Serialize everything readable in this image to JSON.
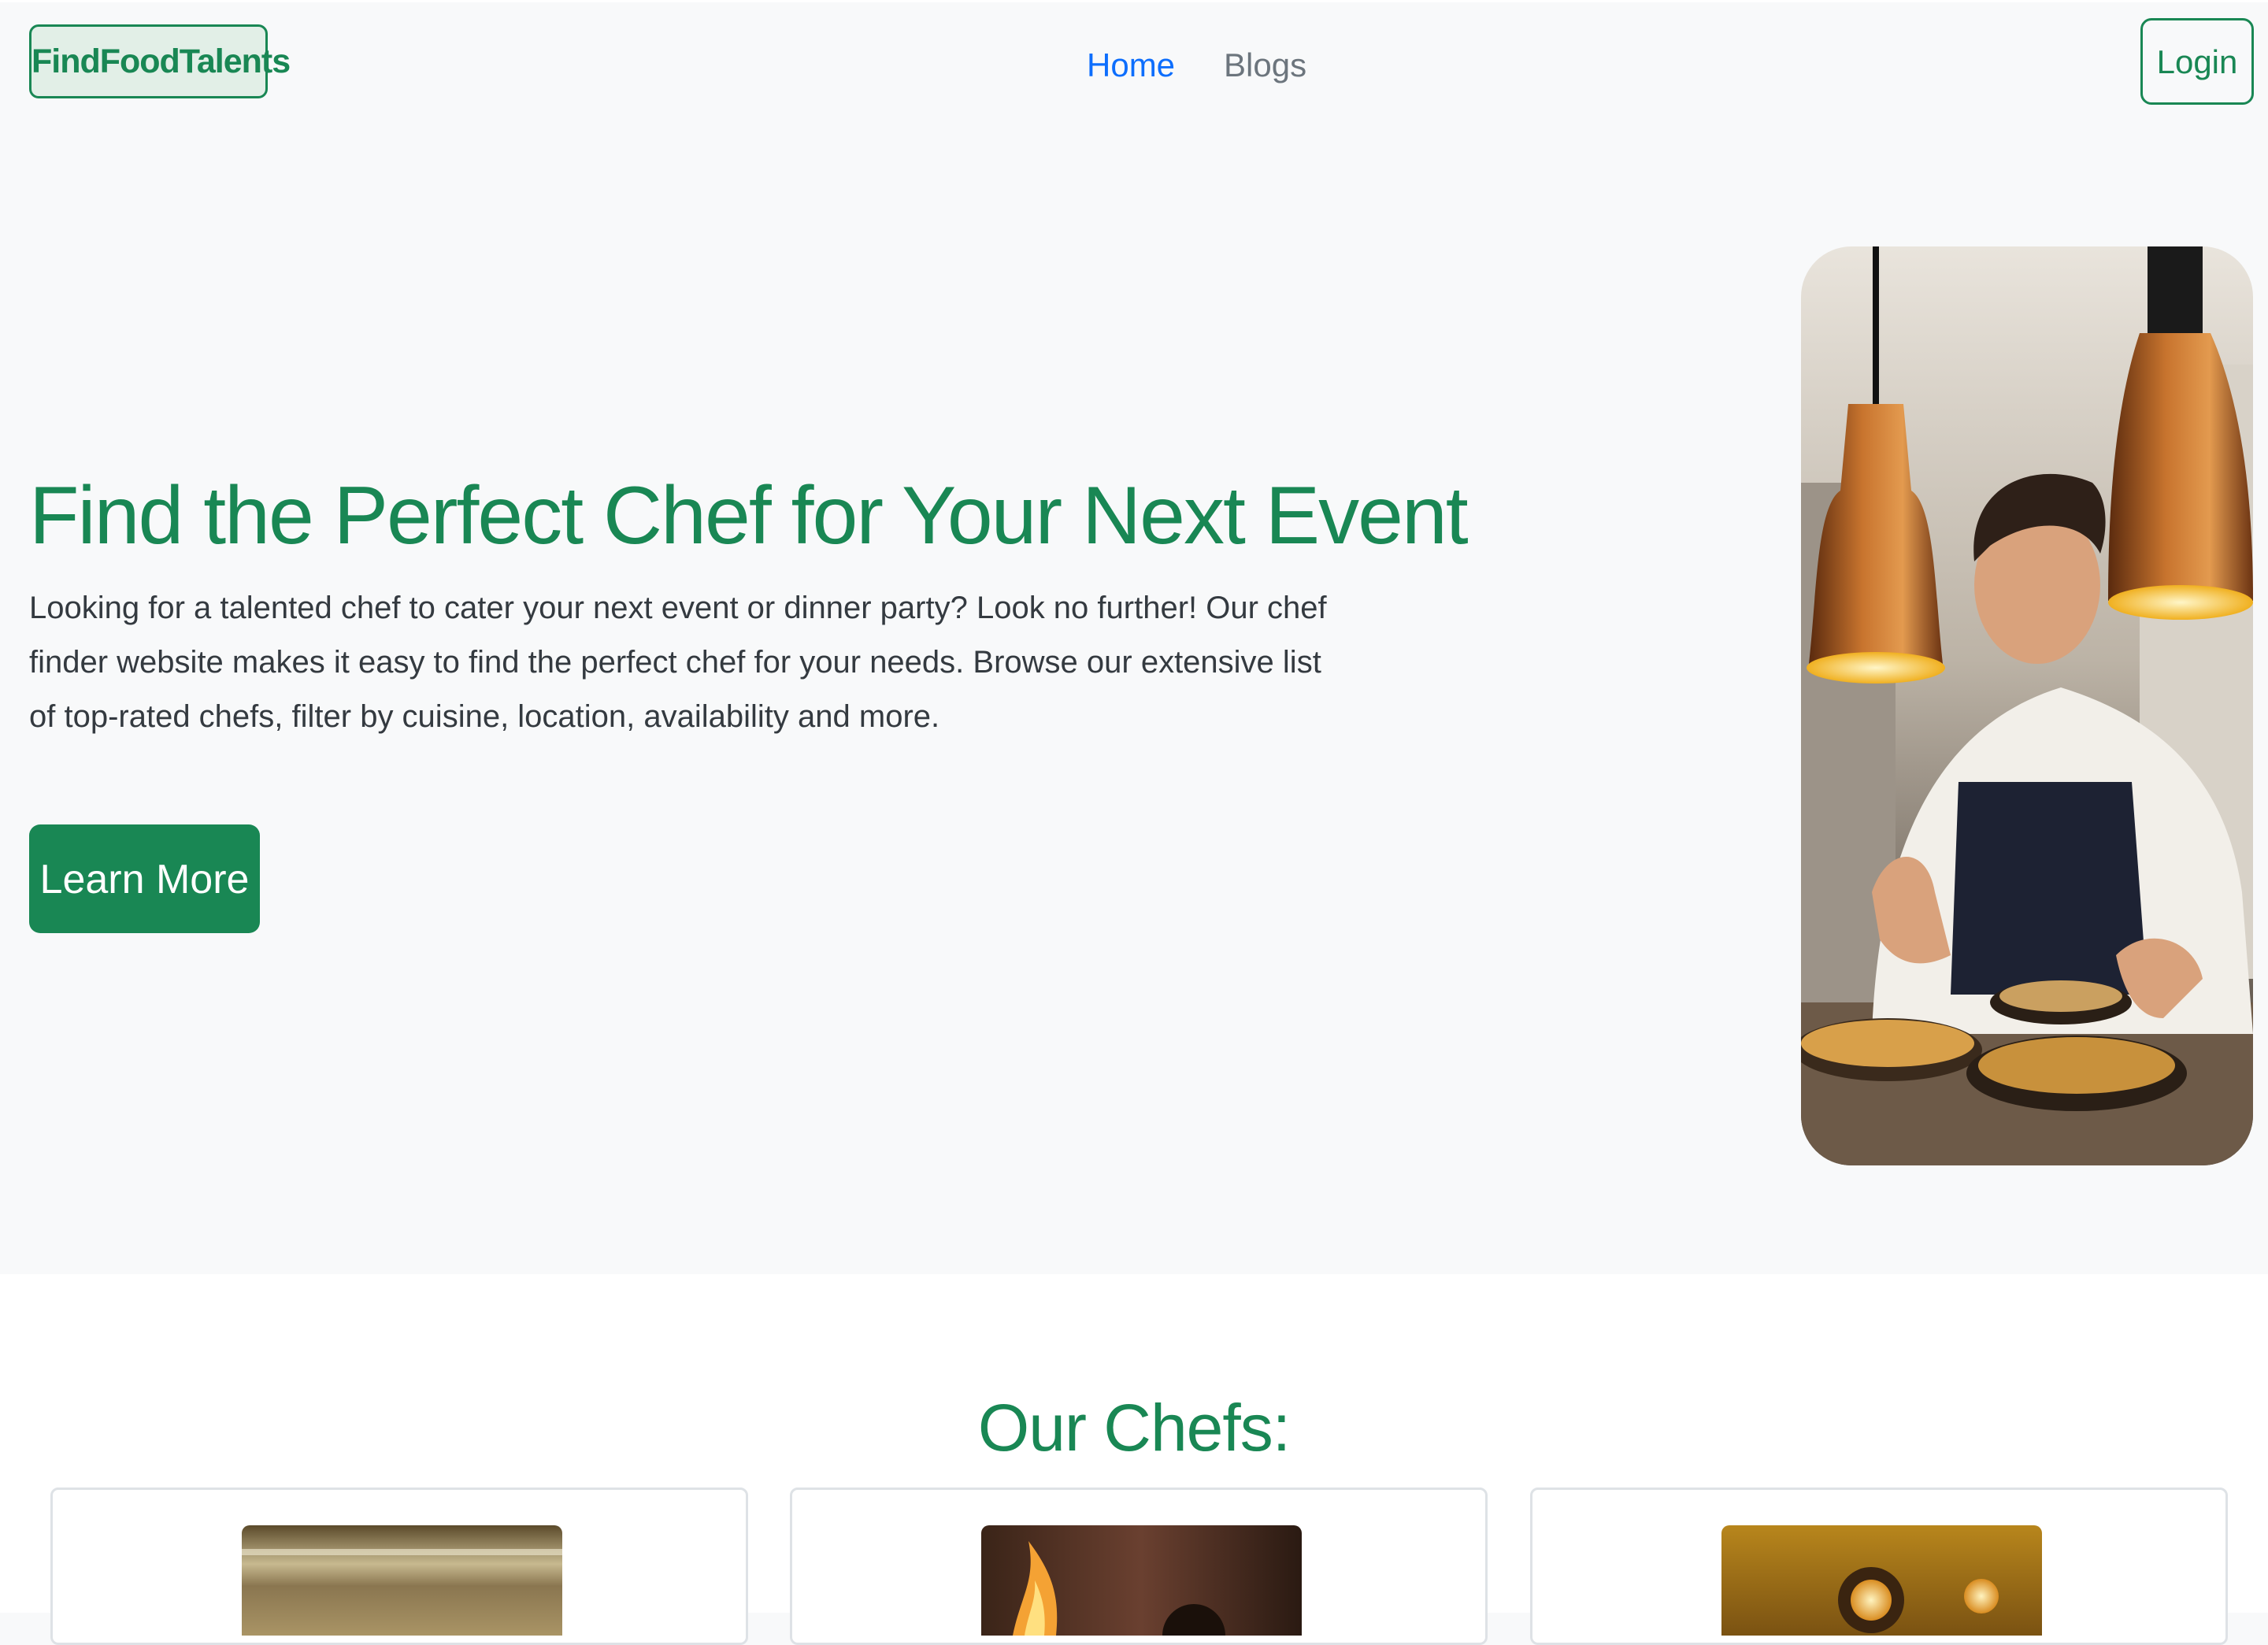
{
  "nav": {
    "brand": "FindFoodTalents",
    "links": [
      {
        "label": "Home",
        "active": true
      },
      {
        "label": "Blogs",
        "active": false
      }
    ],
    "login_label": "Login"
  },
  "hero": {
    "title": "Find the Perfect Chef for Your Next Event",
    "text": "Looking for a talented chef to cater your next event or dinner party? Look no further! Our chef finder website makes it easy to find the perfect chef for your needs. Browse our extensive list of top-rated chefs, filter by cuisine, location, availability and more.",
    "button_label": "Learn More"
  },
  "chefs": {
    "title": "Our Chefs:"
  },
  "colors": {
    "accent": "#198754",
    "link_active": "#0d6efd",
    "link": "#6c757d",
    "background": "#f8f9fa"
  }
}
